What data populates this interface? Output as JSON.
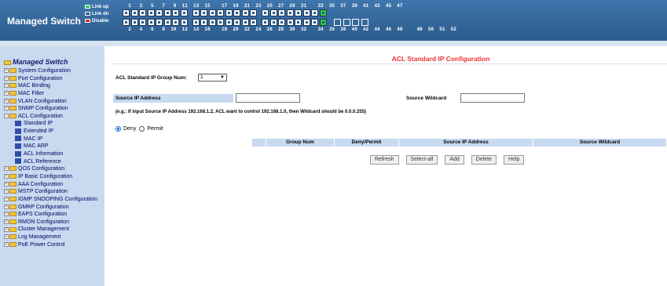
{
  "header": {
    "brand": "Managed Switch",
    "legend": [
      {
        "label": "Link up",
        "color": "#2ecc40"
      },
      {
        "label": "Link dn",
        "color": "#2c5b8c"
      },
      {
        "label": "Disable",
        "color": "#d62b2b"
      }
    ],
    "odd_ports_label": "  1   3   5   7   9  11  13  15    17  19  21  23  25  27  29  31    33  35  37  39  41  43  45  47",
    "even_ports_label": "  2   4   6   8  10  12  14  16    18  20  22  24  26  28  30  32    34  36  38  40  42  44  46  48     49  50  51  52"
  },
  "sidebar": {
    "title": "Managed Switch",
    "items": [
      {
        "label": "System Configuration",
        "type": "folder"
      },
      {
        "label": "Port Configuration",
        "type": "folder"
      },
      {
        "label": "MAC Binding",
        "type": "folder"
      },
      {
        "label": "MAC Filter",
        "type": "folder"
      },
      {
        "label": "VLAN Configuration",
        "type": "folder"
      },
      {
        "label": "SNMP Configuration",
        "type": "folder"
      },
      {
        "label": "ACL Configuration",
        "type": "folder-open"
      },
      {
        "label": "Standard IP",
        "type": "child"
      },
      {
        "label": "Extended IP",
        "type": "child"
      },
      {
        "label": "MAC IP",
        "type": "child"
      },
      {
        "label": "MAC ARP",
        "type": "child"
      },
      {
        "label": "ACL Information",
        "type": "child"
      },
      {
        "label": "ACL Reference",
        "type": "child"
      },
      {
        "label": "QOS Configuration",
        "type": "folder"
      },
      {
        "label": "IP Basic Configuration",
        "type": "folder"
      },
      {
        "label": "AAA Configuration",
        "type": "folder"
      },
      {
        "label": "MSTP Configuration",
        "type": "folder"
      },
      {
        "label": "IGMP SNOOPING Configuration",
        "type": "folder"
      },
      {
        "label": "GMRP Configuration",
        "type": "folder"
      },
      {
        "label": "EAPS Configuration",
        "type": "folder"
      },
      {
        "label": "RMON Configuration",
        "type": "folder"
      },
      {
        "label": "Cluster Management",
        "type": "folder"
      },
      {
        "label": "Log Management",
        "type": "folder"
      },
      {
        "label": "PoE Power Control",
        "type": "folder"
      }
    ]
  },
  "main": {
    "title": "ACL Standard IP Configuration",
    "group_label": "ACL Standard IP Group Num:",
    "group_value": "1",
    "source_ip_label": "Source IP Address",
    "source_ip_value": "",
    "source_wildcard_label": "Source Wildcard",
    "source_wildcard_value": "",
    "hint": "(e.g.: If input Source IP Address 192.168.1.2, ACL want to control 192.168.1.0, then Wildcard should be 0.0.0.255)",
    "deny_label": "Deny",
    "permit_label": "Permit",
    "selected_action": "Deny",
    "table_headers": [
      "",
      "Group Num",
      "Deny/Permit",
      "Source IP Address",
      "Source Wildcard"
    ],
    "buttons": [
      "Refresh",
      "Select-all",
      "Add",
      "Delete",
      "Help"
    ]
  }
}
